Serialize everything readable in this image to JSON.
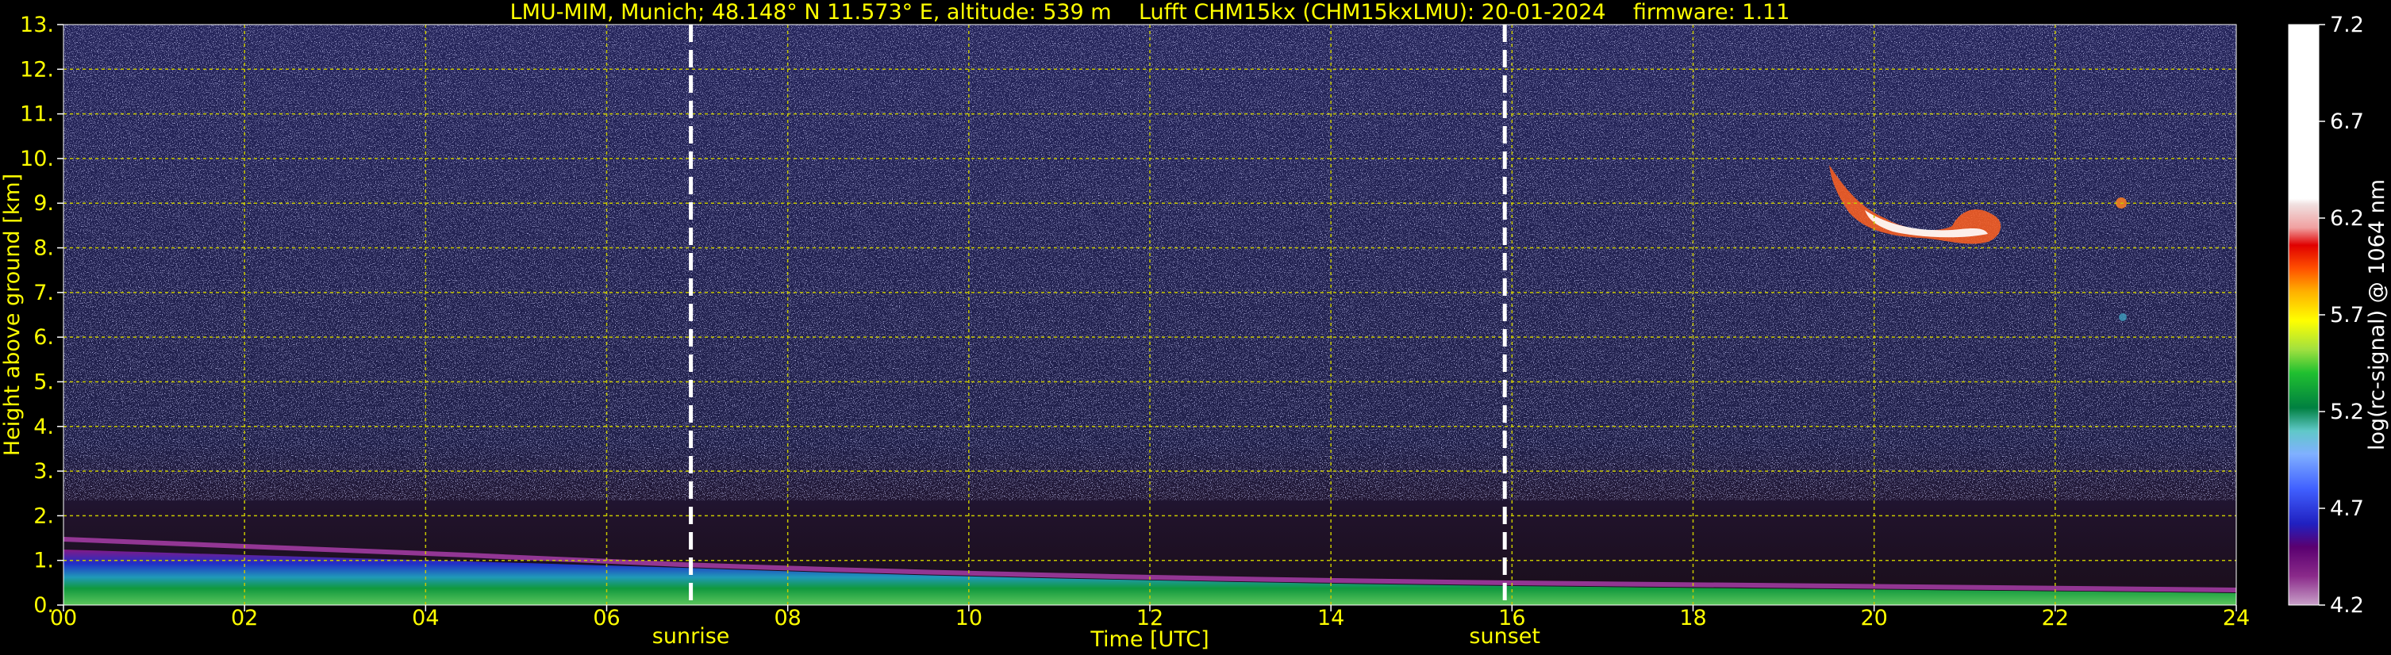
{
  "chart_data": {
    "type": "heatmap",
    "title": "LMU-MIM, Munich; 48.148° N 11.573° E, altitude: 539 m    Lufft CHM15kx (CHM15kxLMU): 20-01-2024    firmware: 1.11",
    "xlabel": "Time [UTC]",
    "ylabel": "Height above ground [km]",
    "xlim": [
      0,
      24
    ],
    "ylim": [
      0,
      13
    ],
    "xticks": [
      "00",
      "02",
      "04",
      "06",
      "08",
      "10",
      "12",
      "14",
      "16",
      "18",
      "20",
      "22",
      "24"
    ],
    "yticks": [
      "0.",
      "1.",
      "2.",
      "3.",
      "4.",
      "5.",
      "6.",
      "7.",
      "8.",
      "9.",
      "10.",
      "11.",
      "12.",
      "13."
    ],
    "grid": true,
    "sunrise": {
      "label": "sunrise",
      "time_utc": 6.93
    },
    "sunset": {
      "label": "sunset",
      "time_utc": 15.92
    },
    "colorbar": {
      "label": "log(rc-signal) @ 1064 nm",
      "range": [
        4.2,
        7.2
      ],
      "ticks": [
        "4.2",
        "4.7",
        "5.2",
        "5.7",
        "6.2",
        "6.7",
        "7.2"
      ]
    },
    "features": [
      {
        "name": "boundary layer aerosol",
        "time": [
          0,
          24
        ],
        "top_km": [
          1.2,
          0.3
        ]
      },
      {
        "name": "cirrus cloud",
        "time": [
          19.5,
          21.3
        ],
        "height_km": [
          7.9,
          9.6
        ]
      },
      {
        "name": "small cloud",
        "time": [
          22.7,
          22.8
        ],
        "height_km": [
          8.6,
          9.4
        ]
      }
    ]
  },
  "colors": {
    "background": "#000000",
    "text": "#ffff00",
    "grid": "#c8c800",
    "noise": "#1c1c4a",
    "marker": "#ffffff"
  }
}
